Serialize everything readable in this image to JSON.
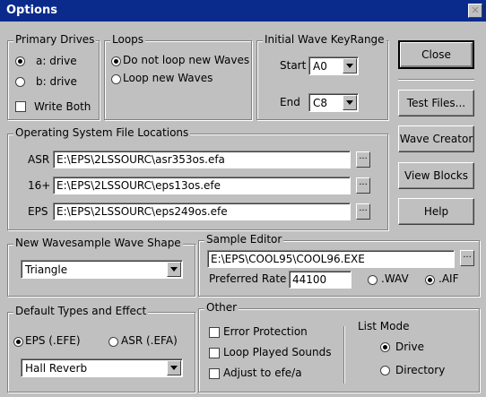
{
  "window": {
    "title": "Options",
    "close_glyph": "✕"
  },
  "primary_drives": {
    "legend": "Primary Drives",
    "a_label": "a: drive",
    "a_selected": true,
    "b_label": "b: drive",
    "b_selected": false,
    "write_both_label": "Write Both",
    "write_both_checked": false
  },
  "loops": {
    "legend": "Loops",
    "no_loop_label": "Do not loop new Waves",
    "no_loop_selected": true,
    "loop_label": "Loop new Waves",
    "loop_selected": false
  },
  "key_range": {
    "legend": "Initial Wave KeyRange",
    "start_label": "Start",
    "start_value": "A0",
    "end_label": "End",
    "end_value": "C8"
  },
  "os_files": {
    "legend": "Operating System File Locations",
    "asr_label": "ASR",
    "asr_path": "E:\\EPS\\2LSSOURC\\asr353os.efa",
    "p16_label": "16+",
    "p16_path": "E:\\EPS\\2LSSOURC\\eps13os.efe",
    "eps_label": "EPS",
    "eps_path": "E:\\EPS\\2LSSOURC\\eps249os.efe",
    "browse_label": "..."
  },
  "buttons": {
    "close": "Close",
    "test_files": "Test Files...",
    "wave_creator": "Wave Creator",
    "view_blocks": "View Blocks",
    "help": "Help"
  },
  "wave_shape": {
    "legend": "New Wavesample Wave Shape",
    "value": "Triangle"
  },
  "sample_editor": {
    "legend": "Sample Editor",
    "path": "E:\\EPS\\COOL95\\COOL96.EXE",
    "browse_label": "...",
    "rate_label": "Preferred Rate",
    "rate_value": "44100",
    "wav_label": ".WAV",
    "wav_selected": false,
    "aif_label": ".AIF",
    "aif_selected": true
  },
  "default_types": {
    "legend": "Default Types and Effect",
    "eps_label": "EPS (.EFE)",
    "eps_selected": true,
    "asr_label": "ASR (.EFA)",
    "asr_selected": false,
    "effect_value": "Hall Reverb"
  },
  "other": {
    "legend": "Other",
    "error_protection_label": "Error Protection",
    "error_protection_checked": false,
    "loop_played_label": "Loop Played Sounds",
    "loop_played_checked": false,
    "adjust_label": "Adjust to efe/a",
    "adjust_checked": false,
    "list_mode_label": "List Mode",
    "drive_label": "Drive",
    "drive_selected": true,
    "directory_label": "Directory",
    "directory_selected": false
  }
}
